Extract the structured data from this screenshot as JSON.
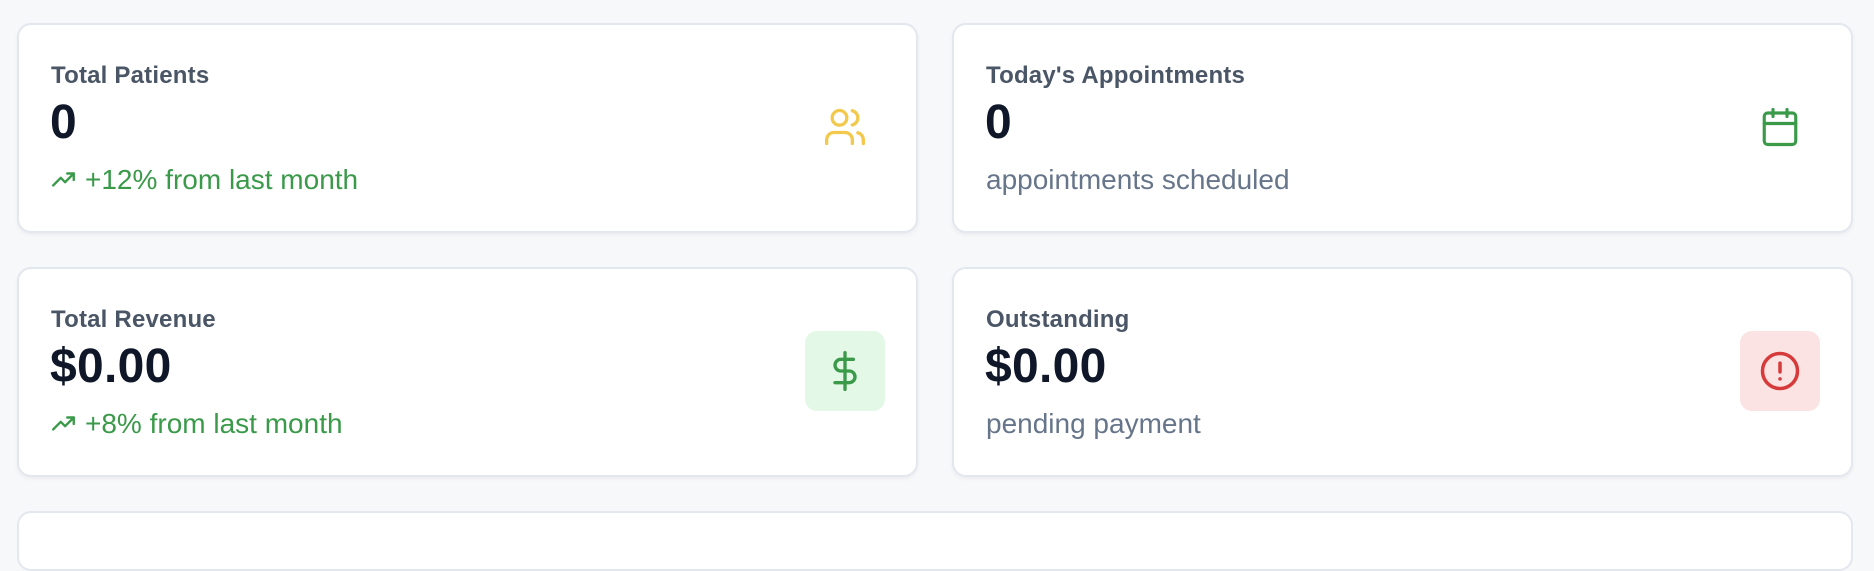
{
  "stats": [
    {
      "label": "Total Patients",
      "value": "0",
      "subtext": "+12% from last month",
      "sub_style": "trend",
      "icon": "users-icon",
      "icon_color": "#f2c94c",
      "icon_bg": "none"
    },
    {
      "label": "Today's Appointments",
      "value": "0",
      "subtext": "appointments scheduled",
      "sub_style": "muted",
      "icon": "calendar-icon",
      "icon_color": "#3a9a4a",
      "icon_bg": "none"
    },
    {
      "label": "Total Revenue",
      "value": "$0.00",
      "subtext": "+8% from last month",
      "sub_style": "trend",
      "icon": "dollar-icon",
      "icon_color": "#3a9a4a",
      "icon_bg": "#e3f8e6"
    },
    {
      "label": "Outstanding",
      "value": "$0.00",
      "subtext": "pending payment",
      "sub_style": "muted",
      "icon": "alert-circle-icon",
      "icon_color": "#d63a3a",
      "icon_bg": "#fbe3e3"
    }
  ],
  "colors": {
    "page_bg": "#f7f8fa",
    "card_border": "#e3e7ee",
    "value_text": "#0f1729",
    "label_text": "#4a5566",
    "muted_text": "#66758a",
    "trend_green": "#3a9a4a"
  }
}
